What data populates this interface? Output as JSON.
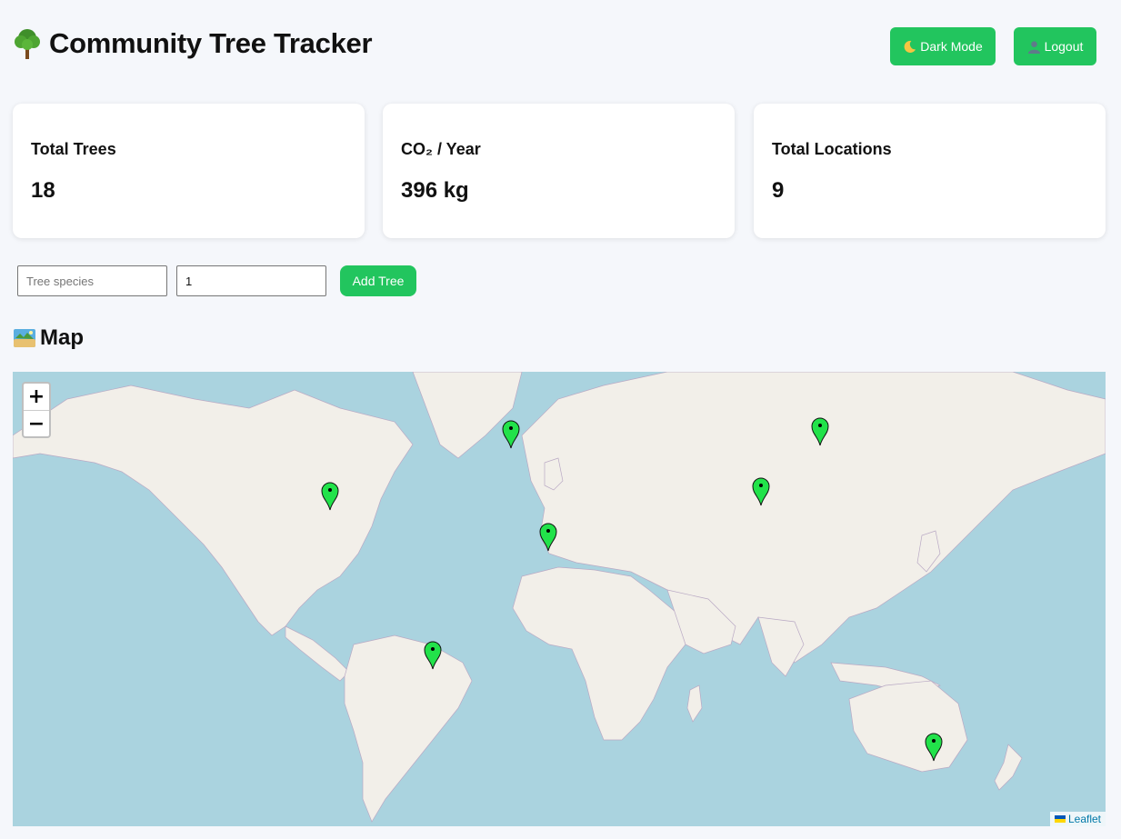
{
  "app": {
    "title": "Community Tree Tracker"
  },
  "header": {
    "dark_mode_label": "Dark Mode",
    "logout_label": "Logout"
  },
  "stats": [
    {
      "label": "Total Trees",
      "value": "18"
    },
    {
      "label": "CO₂ / Year",
      "value": "396 kg"
    },
    {
      "label": "Total Locations",
      "value": "9"
    }
  ],
  "form": {
    "species_placeholder": "Tree species",
    "species_value": "",
    "count_value": "1",
    "add_label": "Add Tree"
  },
  "map": {
    "heading": "Map",
    "zoom_in": "+",
    "zoom_out": "−",
    "attribution": "Leaflet",
    "markers": [
      {
        "name": "Iceland"
      },
      {
        "name": "Western Siberia"
      },
      {
        "name": "Great Lakes"
      },
      {
        "name": "Kazakhstan"
      },
      {
        "name": "Iberia"
      },
      {
        "name": "Brazil"
      },
      {
        "name": "Australia"
      }
    ]
  },
  "colors": {
    "accent": "#22c55e",
    "water": "#aad3df",
    "land": "#f2efe9",
    "marker": "#22e24a"
  }
}
